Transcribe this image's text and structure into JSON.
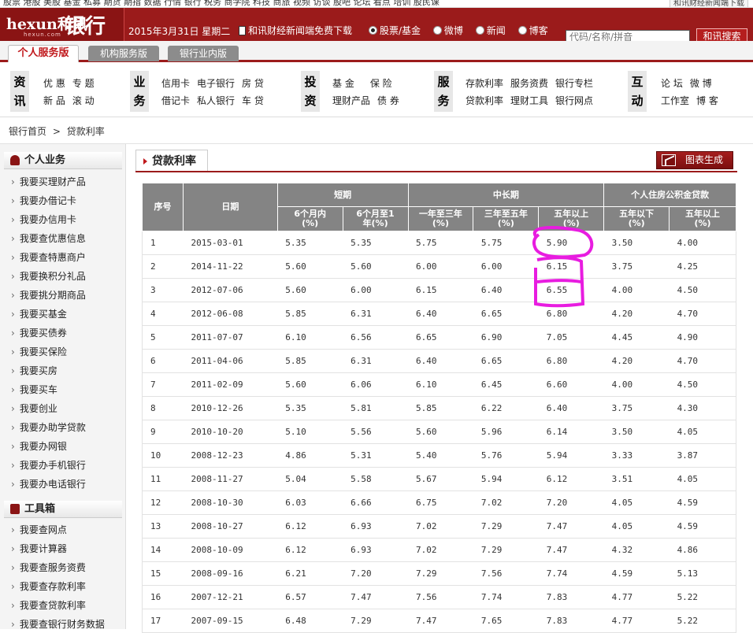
{
  "top_strip": {
    "left_text": "股票 港股 美股  基金 私募  期货 期指 数据 行情  银行 税务 商学院 科技 商旅  视频 访谈  股吧 论坛 看点  培训 股民课",
    "right_text": "和讯财经新闻端下载"
  },
  "header": {
    "logo_mark": "hexun和讯",
    "logo_sub": "hexun.com",
    "logo_bank": "银行",
    "date": "2015年3月31日 星期二",
    "download_link": "和讯财经新闻端免费下载",
    "radios": [
      {
        "label": "股票/基金",
        "selected": true
      },
      {
        "label": "微博",
        "selected": false
      },
      {
        "label": "新闻",
        "selected": false
      },
      {
        "label": "博客",
        "selected": false
      }
    ],
    "search_placeholder": "代码/名称/拼音",
    "search_button": "和讯搜索"
  },
  "tabs": [
    {
      "label": "个人服务版",
      "active": true
    },
    {
      "label": "机构服务版",
      "active": false
    },
    {
      "label": "银行业内版",
      "active": false
    }
  ],
  "nav": [
    {
      "category": "资讯",
      "rows": [
        [
          "优 惠",
          "专 题"
        ],
        [
          "新 品",
          "滚 动"
        ]
      ]
    },
    {
      "category": "业务",
      "rows": [
        [
          "信用卡",
          "电子银行",
          "房 贷"
        ],
        [
          "借记卡",
          "私人银行",
          "车 贷"
        ]
      ]
    },
    {
      "category": "投资",
      "rows": [
        [
          "基 金",
          "保 险"
        ],
        [
          "理财产品",
          "债 券"
        ]
      ]
    },
    {
      "category": "服务",
      "rows": [
        [
          "存款利率",
          "服务资费",
          "银行专栏"
        ],
        [
          "贷款利率",
          "理财工具",
          "银行网点"
        ]
      ]
    },
    {
      "category": "互动",
      "rows": [
        [
          "论 坛",
          "微 博"
        ],
        [
          "工作室",
          "博 客"
        ]
      ]
    }
  ],
  "breadcrumb": {
    "home": "银行首页",
    "sep": ">",
    "current": "贷款利率"
  },
  "sidebar": {
    "personal_title": "个人业务",
    "personal_items": [
      "我要买理财产品",
      "我要办借记卡",
      "我要办信用卡",
      "我要查优惠信息",
      "我要查特惠商户",
      "我要换积分礼品",
      "我要挑分期商品",
      "我要买基金",
      "我要买债券",
      "我要买保险",
      "我要买房",
      "我要买车",
      "我要创业",
      "我要办助学贷款",
      "我要办网银",
      "我要办手机银行",
      "我要办电话银行"
    ],
    "tools_title": "工具箱",
    "tools_items": [
      "我要查网点",
      "我要计算器",
      "我要查服务资费",
      "我要查存款利率",
      "我要查贷款利率",
      "我要查银行财务数据"
    ]
  },
  "content": {
    "title": "贷款利率",
    "chart_button": "图表生成",
    "table": {
      "col_seq": "序号",
      "col_date": "日期",
      "group_short": "短期",
      "group_long": "中长期",
      "group_fund": "个人住房公积金贷款",
      "sub_headers": [
        "6个月内(%)",
        "6个月至1年(%)",
        "一年至三年(%)",
        "三年至五年(%)",
        "五年以上(%)",
        "五年以下(%)",
        "五年以上(%)"
      ],
      "rows": [
        [
          "1",
          "2015-03-01",
          "5.35",
          "5.35",
          "5.75",
          "5.75",
          "5.90",
          "3.50",
          "4.00"
        ],
        [
          "2",
          "2014-11-22",
          "5.60",
          "5.60",
          "6.00",
          "6.00",
          "6.15",
          "3.75",
          "4.25"
        ],
        [
          "3",
          "2012-07-06",
          "5.60",
          "6.00",
          "6.15",
          "6.40",
          "6.55",
          "4.00",
          "4.50"
        ],
        [
          "4",
          "2012-06-08",
          "5.85",
          "6.31",
          "6.40",
          "6.65",
          "6.80",
          "4.20",
          "4.70"
        ],
        [
          "5",
          "2011-07-07",
          "6.10",
          "6.56",
          "6.65",
          "6.90",
          "7.05",
          "4.45",
          "4.90"
        ],
        [
          "6",
          "2011-04-06",
          "5.85",
          "6.31",
          "6.40",
          "6.65",
          "6.80",
          "4.20",
          "4.70"
        ],
        [
          "7",
          "2011-02-09",
          "5.60",
          "6.06",
          "6.10",
          "6.45",
          "6.60",
          "4.00",
          "4.50"
        ],
        [
          "8",
          "2010-12-26",
          "5.35",
          "5.81",
          "5.85",
          "6.22",
          "6.40",
          "3.75",
          "4.30"
        ],
        [
          "9",
          "2010-10-20",
          "5.10",
          "5.56",
          "5.60",
          "5.96",
          "6.14",
          "3.50",
          "4.05"
        ],
        [
          "10",
          "2008-12-23",
          "4.86",
          "5.31",
          "5.40",
          "5.76",
          "5.94",
          "3.33",
          "3.87"
        ],
        [
          "11",
          "2008-11-27",
          "5.04",
          "5.58",
          "5.67",
          "5.94",
          "6.12",
          "3.51",
          "4.05"
        ],
        [
          "12",
          "2008-10-30",
          "6.03",
          "6.66",
          "6.75",
          "7.02",
          "7.20",
          "4.05",
          "4.59"
        ],
        [
          "13",
          "2008-10-27",
          "6.12",
          "6.93",
          "7.02",
          "7.29",
          "7.47",
          "4.05",
          "4.59"
        ],
        [
          "14",
          "2008-10-09",
          "6.12",
          "6.93",
          "7.02",
          "7.29",
          "7.47",
          "4.32",
          "4.86"
        ],
        [
          "15",
          "2008-09-16",
          "6.21",
          "7.20",
          "7.29",
          "7.56",
          "7.74",
          "4.59",
          "5.13"
        ],
        [
          "16",
          "2007-12-21",
          "6.57",
          "7.47",
          "7.56",
          "7.74",
          "7.83",
          "4.77",
          "5.22"
        ],
        [
          "17",
          "2007-09-15",
          "6.48",
          "7.29",
          "7.47",
          "7.65",
          "7.83",
          "4.77",
          "5.22"
        ]
      ]
    }
  },
  "annotation_color": "#e81ce0"
}
